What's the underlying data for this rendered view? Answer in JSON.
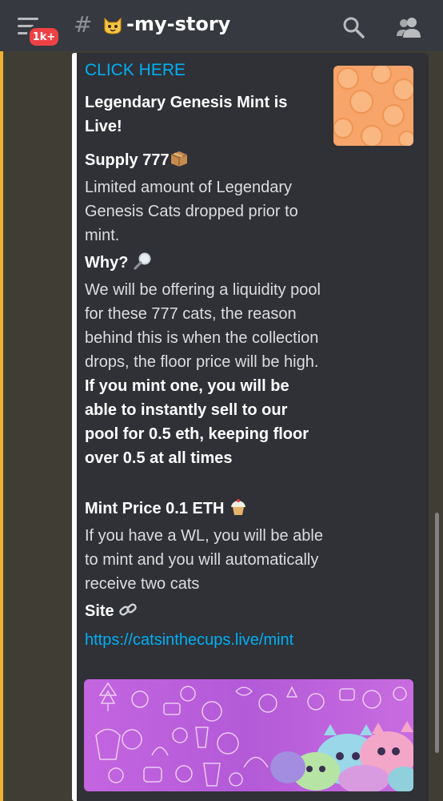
{
  "header": {
    "badge": "1k+",
    "hash": "#",
    "channel_name": "-my-story",
    "channel_emoji_icon": "cat-face-icon",
    "menu_icon": "hamburger-menu-icon",
    "search_icon": "search-icon",
    "members_icon": "members-icon"
  },
  "embed": {
    "link_text": "CLICK HERE",
    "title": "Legendary Genesis Mint is Live!",
    "fields": [
      {
        "name": "Supply 777",
        "name_icon": "package-icon",
        "value": "Limited amount of Legendary Genesis Cats dropped prior to mint."
      },
      {
        "name": "Why?",
        "name_icon": "magnifying-glass-icon",
        "value": "We will be offering a liquidity pool for these 777 cats, the reason behind this is when the collection drops, the floor price will be high.",
        "value_bold": "If you mint one, you will be able to instantly sell to our pool for 0.5 eth, keeping floor over 0.5 at all times"
      },
      {
        "name": "Mint Price 0.1 ETH",
        "name_icon": "cupcake-icon",
        "value": "If you have a WL, you will be able to mint and you will automatically receive two cats"
      },
      {
        "name": "Site",
        "name_icon": "link-icon",
        "value": "https://catsinthecups.live/mint"
      }
    ],
    "thumbnail_icon": "orange-pattern-thumbnail",
    "banner_image": "cats-in-cups-banner-image"
  },
  "colors": {
    "background": "#36393f",
    "embed": "#2f3136",
    "link": "#00aff4",
    "badge": "#ed4245",
    "unread_strip": "#f0b232"
  }
}
